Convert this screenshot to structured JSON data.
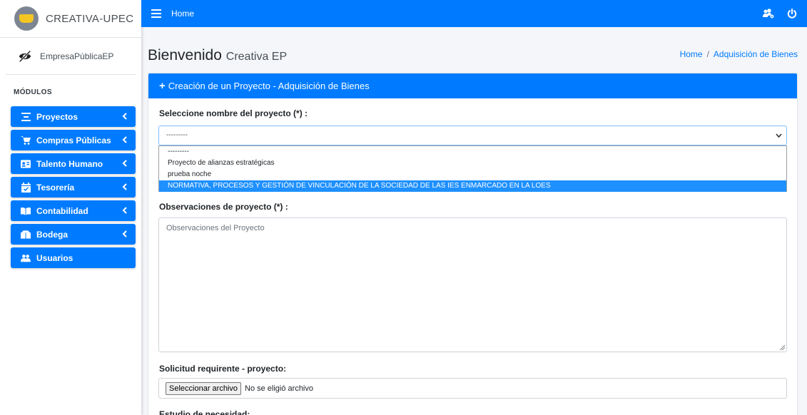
{
  "brand": {
    "name": "CREATIVA-UPEC"
  },
  "user": {
    "name": "EmpresaPúblicaEP"
  },
  "nav": {
    "header": "MÓDULOS",
    "items": [
      {
        "label": "Proyectos",
        "icon": "align-center-icon",
        "has_submenu": true
      },
      {
        "label": "Compras Públicas",
        "icon": "shopping-cart-icon",
        "has_submenu": true
      },
      {
        "label": "Talento Humano",
        "icon": "id-card-icon",
        "has_submenu": true
      },
      {
        "label": "Tesorería",
        "icon": "calendar-check-icon",
        "has_submenu": true
      },
      {
        "label": "Contabilidad",
        "icon": "book-open-icon",
        "has_submenu": true
      },
      {
        "label": "Bodega",
        "icon": "boxes-icon",
        "has_submenu": true
      },
      {
        "label": "Usuarios",
        "icon": "users-icon",
        "has_submenu": false
      }
    ]
  },
  "topbar": {
    "home_label": "Home",
    "right_icons": [
      "users-cog-icon",
      "power-icon"
    ]
  },
  "content": {
    "title": "Bienvenido",
    "subtitle": "Creativa EP",
    "breadcrumb": {
      "home": "Home",
      "separator": "/",
      "current": "Adquisición de Bienes"
    }
  },
  "card": {
    "header": "Creación de un Proyecto - Adquisición de Bienes",
    "project_label": "Seleccione nombre del proyecto (*) :",
    "project_select_value": "---------",
    "project_options": [
      "---------",
      "Proyecto de alianzas estratégicas",
      "prueba noche",
      "NORMATIVA, PROCESOS Y GESTIÓN DE VINCULACIÓN DE LA SOCIEDAD DE LAS IES ENMARCADO EN LA LOES"
    ],
    "highlighted_option_index": 3,
    "observations_label": "Observaciones de proyecto (*) :",
    "observations_placeholder": "Observaciones del Proyecto",
    "request_label": "Solicitud requirente - proyecto:",
    "file_button": "Seleccionar archivo",
    "file_status": "No se eligió archivo",
    "study_label": "Estudio de necesidad:"
  },
  "colors": {
    "primary": "#007bff",
    "highlight": "#1e90ff",
    "background": "#f4f6f9"
  }
}
